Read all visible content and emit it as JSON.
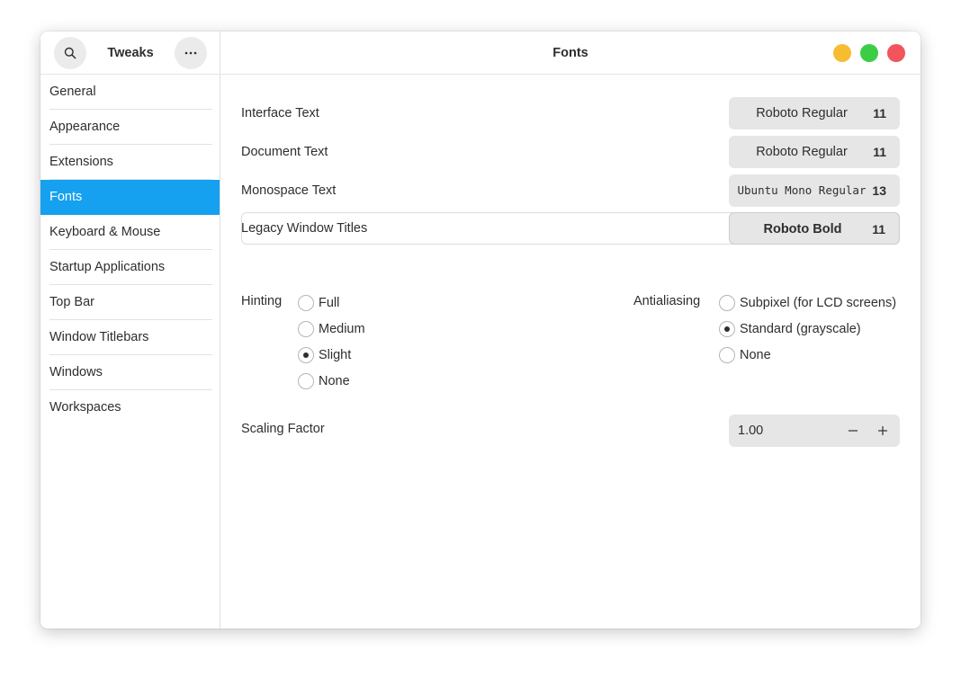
{
  "app": {
    "title": "Tweaks"
  },
  "header": {
    "title": "Fonts"
  },
  "window_controls": {
    "minimize_color": "#f6bd33",
    "maximize_color": "#3ccd47",
    "close_color": "#f2545b"
  },
  "sidebar": {
    "active_color": "#15a0f0",
    "items": [
      {
        "label": "General"
      },
      {
        "label": "Appearance"
      },
      {
        "label": "Extensions"
      },
      {
        "label": "Fonts",
        "active": true
      },
      {
        "label": "Keyboard & Mouse"
      },
      {
        "label": "Startup Applications"
      },
      {
        "label": "Top Bar"
      },
      {
        "label": "Window Titlebars"
      },
      {
        "label": "Windows"
      },
      {
        "label": "Workspaces"
      }
    ]
  },
  "fonts": {
    "interface": {
      "label": "Interface Text",
      "font": "Roboto Regular",
      "size": "11"
    },
    "document": {
      "label": "Document Text",
      "font": "Roboto Regular",
      "size": "11"
    },
    "monospace": {
      "label": "Monospace Text",
      "font": "Ubuntu Mono Regular",
      "size": "13"
    },
    "legacy_titles": {
      "label": "Legacy Window Titles",
      "font": "Roboto Bold",
      "size": "11"
    }
  },
  "hinting": {
    "label": "Hinting",
    "options": [
      "Full",
      "Medium",
      "Slight",
      "None"
    ],
    "selected": "Slight"
  },
  "antialiasing": {
    "label": "Antialiasing",
    "options": [
      "Subpixel (for LCD screens)",
      "Standard (grayscale)",
      "None"
    ],
    "selected": "Standard (grayscale)"
  },
  "scaling": {
    "label": "Scaling Factor",
    "value": "1.00"
  }
}
